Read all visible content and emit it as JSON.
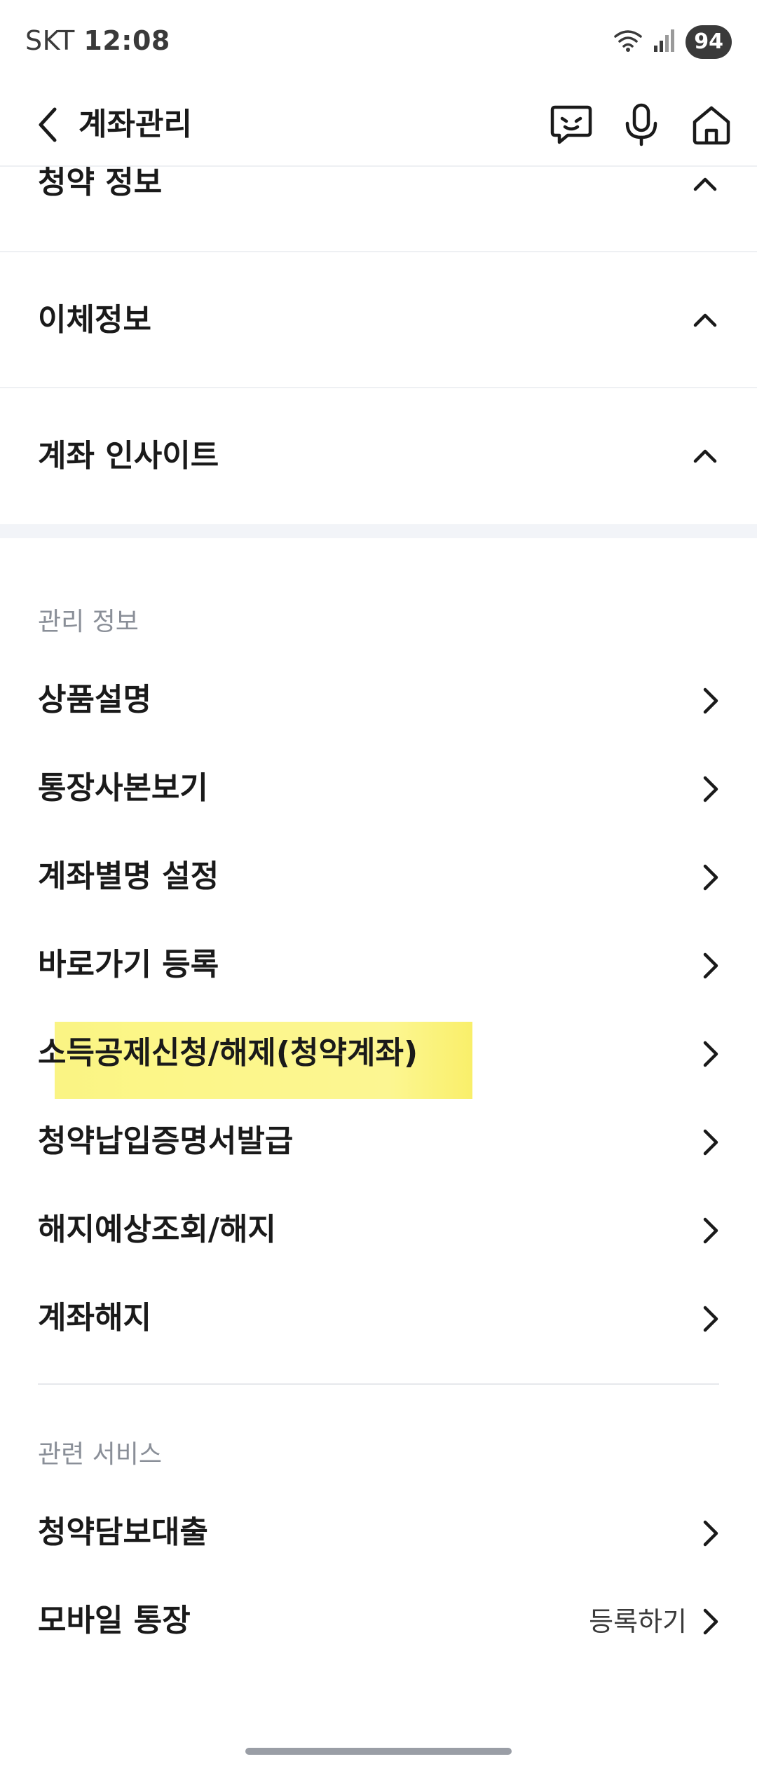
{
  "status_bar": {
    "carrier": "SKT",
    "time": "12:08",
    "battery": "94"
  },
  "header": {
    "title": "계좌관리",
    "icons": [
      "back-arrow-icon",
      "chatbot-icon",
      "microphone-icon",
      "home-icon"
    ]
  },
  "accordions": [
    {
      "label": "청약 정보",
      "state": "expanded"
    },
    {
      "label": "이체정보",
      "state": "expanded"
    },
    {
      "label": "계좌 인사이트",
      "state": "expanded"
    }
  ],
  "management": {
    "section_title": "관리 정보",
    "items": [
      {
        "label": "상품설명"
      },
      {
        "label": "통장사본보기"
      },
      {
        "label": "계좌별명 설정"
      },
      {
        "label": "바로가기 등록"
      },
      {
        "label": "소득공제신청/해제(청약계좌)",
        "highlighted": true
      },
      {
        "label": "청약납입증명서발급"
      },
      {
        "label": "해지예상조회/해지"
      },
      {
        "label": "계좌해지"
      }
    ]
  },
  "related": {
    "section_title": "관련 서비스",
    "items": [
      {
        "label": "청약담보대출"
      },
      {
        "label": "모바일 통장",
        "action": "등록하기"
      }
    ]
  },
  "colors": {
    "highlight": "#fcf48a",
    "divider": "#eef0f3",
    "section_gap": "#f2f4f8",
    "muted_text": "#8a8f98"
  }
}
